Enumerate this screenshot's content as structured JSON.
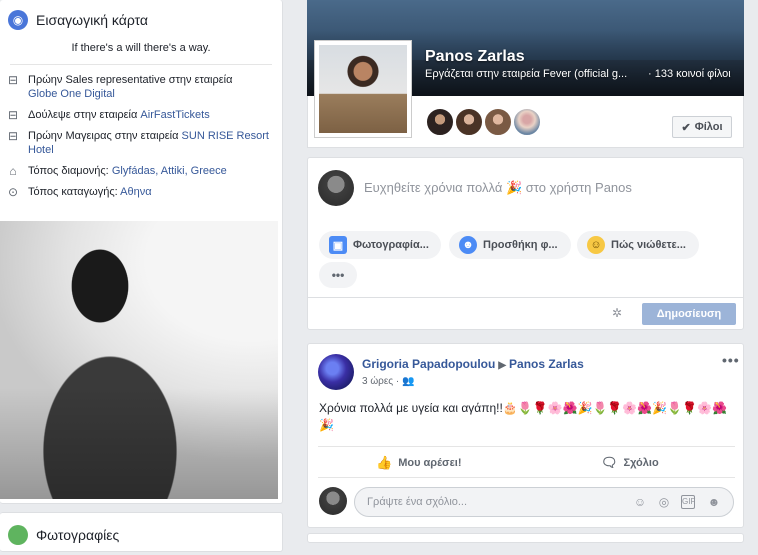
{
  "intro": {
    "title": "Εισαγωγική κάρτα",
    "bio": "If there's a will there's a way.",
    "items": [
      {
        "icon": "briefcase-icon",
        "prefix": "Πρώην Sales representative στην εταιρεία",
        "link": "Globe One Digital"
      },
      {
        "icon": "briefcase-icon",
        "prefix": "Δούλεψε στην εταιρεία",
        "link": "AirFastTickets"
      },
      {
        "icon": "briefcase-icon",
        "prefix": "Πρώην Μαγειρας στην εταιρεία",
        "link": "SUN RISE Resort Hotel"
      },
      {
        "icon": "home-icon",
        "prefix": "Τόπος διαμονής:",
        "link": "Glyfádas, Attiki, Greece"
      },
      {
        "icon": "location-pin-icon",
        "prefix": "Τόπος καταγωγής:",
        "link": "Αθηνα"
      }
    ]
  },
  "photos": {
    "title": "Φωτογραφίες"
  },
  "profile": {
    "name": "Panos Zarlas",
    "work": "Εργάζεται στην εταιρεία Fever (official g...",
    "mutual_friends": "· 133 κοινοί φίλοι",
    "friends_button": "Φίλοι"
  },
  "composer": {
    "placeholder": "Ευχηθείτε χρόνια πολλά 🎉 στο χρήστη Panos",
    "chips": [
      "Φωτογραφία...",
      "Προσθήκη φ...",
      "Πώς νιώθετε..."
    ],
    "more": "•••",
    "publish": "Δημοσίευση"
  },
  "post": {
    "author": "Grigoria Papadopoulou",
    "target": "Panos Zarlas",
    "time": "3 ώρες ·",
    "text": "Χρόνια πολλά με υγεία και αγάπη!!🎂🌷🌹🌸🌺🎉🌷🌹🌸🌺🎉🌷🌹🌸🌺🎉",
    "like": "Μου αρέσει!",
    "comment": "Σχόλιο",
    "comment_placeholder": "Γράψτε ένα σχόλιο...",
    "more": "•••"
  },
  "colors": {
    "link": "#365899",
    "publish_disabled": "#9cb4d8",
    "bg": "#e9ebee"
  }
}
